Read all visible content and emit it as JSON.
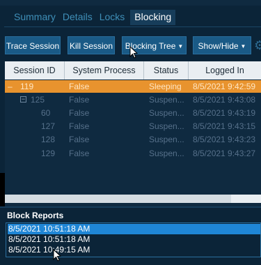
{
  "tabs": [
    {
      "label": "Summary"
    },
    {
      "label": "Details"
    },
    {
      "label": "Locks"
    },
    {
      "label": "Blocking"
    }
  ],
  "toolbar": {
    "trace_session": "Trace Session",
    "kill_session": "Kill Session",
    "blocking_tree": "Blocking Tree",
    "show_hide": "Show/Hide"
  },
  "grid": {
    "columns": [
      "Session ID",
      "System Process",
      "Status",
      "Logged In"
    ],
    "rows": [
      {
        "session_id": "119",
        "system_process": "False",
        "status": "Sleeping",
        "logged_in": "8/5/2021 9:42:59"
      },
      {
        "session_id": "125",
        "system_process": "False",
        "status": "Suspen...",
        "logged_in": "8/5/2021 9:43:08"
      },
      {
        "session_id": "60",
        "system_process": "False",
        "status": "Suspen...",
        "logged_in": "8/5/2021 9:43:19"
      },
      {
        "session_id": "127",
        "system_process": "False",
        "status": "Suspen...",
        "logged_in": "8/5/2021 9:43:15"
      },
      {
        "session_id": "128",
        "system_process": "False",
        "status": "Suspen...",
        "logged_in": "8/5/2021 9:43:23"
      },
      {
        "session_id": "129",
        "system_process": "False",
        "status": "Suspen...",
        "logged_in": "8/5/2021 9:43:27"
      }
    ]
  },
  "block_reports": {
    "title": "Block Reports",
    "items": [
      {
        "label": "8/5/2021 10:51:18 AM"
      },
      {
        "label": "8/5/2021 10:51:18 AM"
      },
      {
        "label": "8/5/2021 10:49:15 AM"
      }
    ]
  },
  "colors": {
    "background": "#0b2438",
    "selected_row": "#e8932e",
    "selected_list_item": "#1f86d6",
    "button": "#1a5a86",
    "tab_inactive": "#3f8fb8"
  },
  "icons": {
    "expander": "collapse-minus-icon",
    "settings": "gear-icon",
    "cursor": "mouse-pointer-icon"
  }
}
